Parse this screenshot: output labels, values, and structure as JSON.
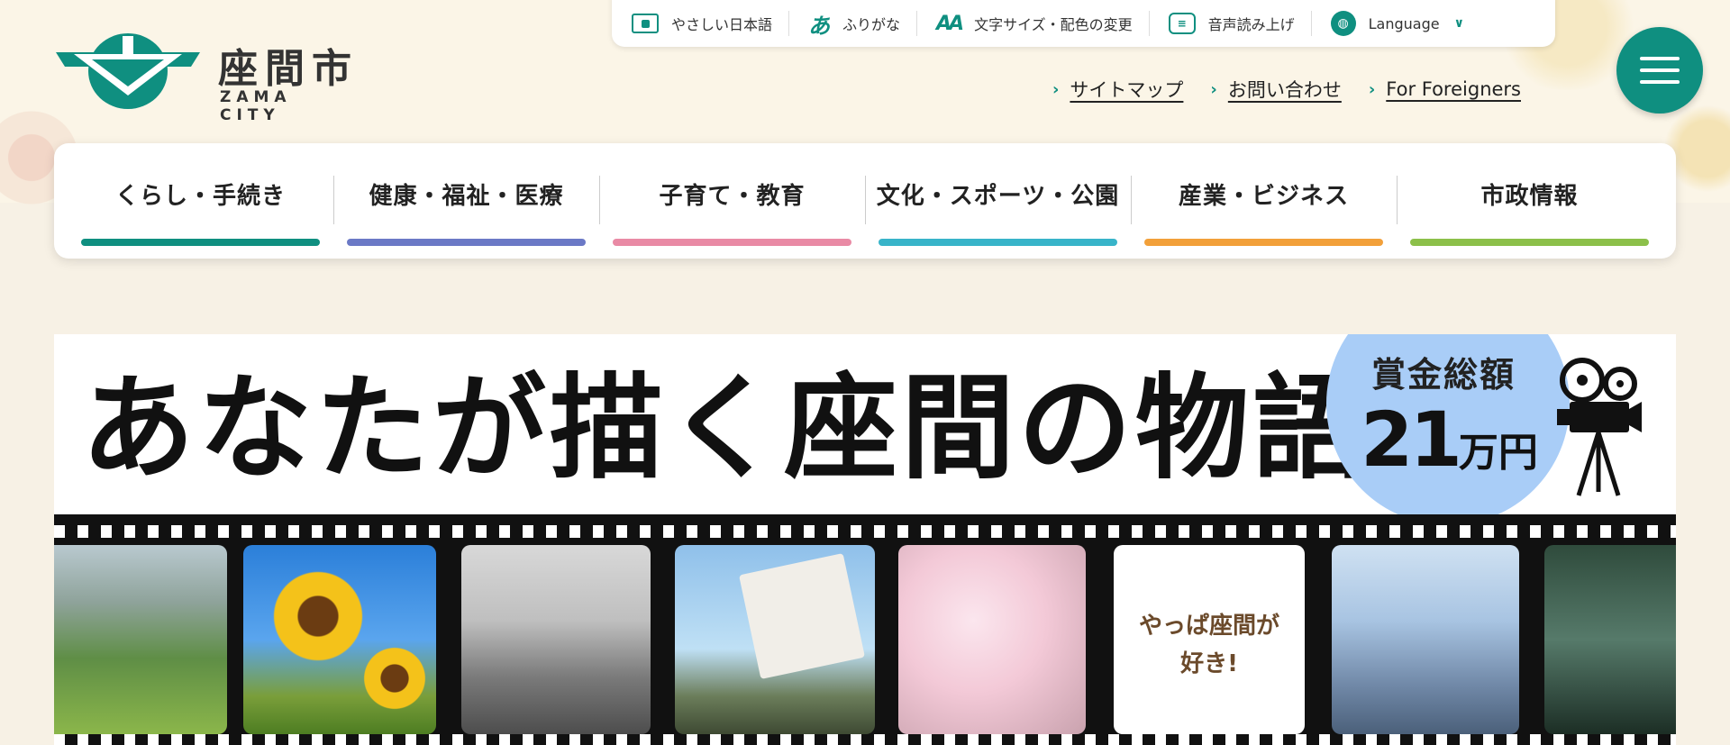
{
  "header": {
    "logo": {
      "name": "座間市",
      "name_en": "ZAMA CITY"
    },
    "utility": [
      {
        "icon": "easy-japanese-icon",
        "label": "やさしい日本語"
      },
      {
        "icon": "furigana-icon",
        "label": "ふりがな"
      },
      {
        "icon": "font-size-color-icon",
        "label": "文字サイズ・配色の変更"
      },
      {
        "icon": "voice-reading-icon",
        "label": "音声読み上げ"
      },
      {
        "icon": "globe-icon",
        "label": "Language"
      }
    ],
    "links": [
      {
        "label": "サイトマップ"
      },
      {
        "label": "お問い合わせ"
      },
      {
        "label": "For Foreigners"
      }
    ],
    "menu_button": {
      "icon": "hamburger-icon"
    }
  },
  "gnav": [
    {
      "label": "くらし・手続き",
      "color": "#0f8f80"
    },
    {
      "label": "健康・福祉・医療",
      "color": "#6b79c6"
    },
    {
      "label": "子育て・教育",
      "color": "#e98aa5"
    },
    {
      "label": "文化・スポーツ・公園",
      "color": "#38b4c9"
    },
    {
      "label": "産業・ビジネス",
      "color": "#f2a03a"
    },
    {
      "label": "市政情報",
      "color": "#8cc04a"
    }
  ],
  "banner": {
    "title": "あなたが描く座間の物語",
    "prize_label": "賞金総額",
    "prize_amount": "21",
    "prize_unit": "万円",
    "frame_text": "やっぱ座間が好き!"
  },
  "colors": {
    "accent": "#0f8f80",
    "background": "#f7f1e5",
    "prize_circle": "#a9cdf7"
  }
}
